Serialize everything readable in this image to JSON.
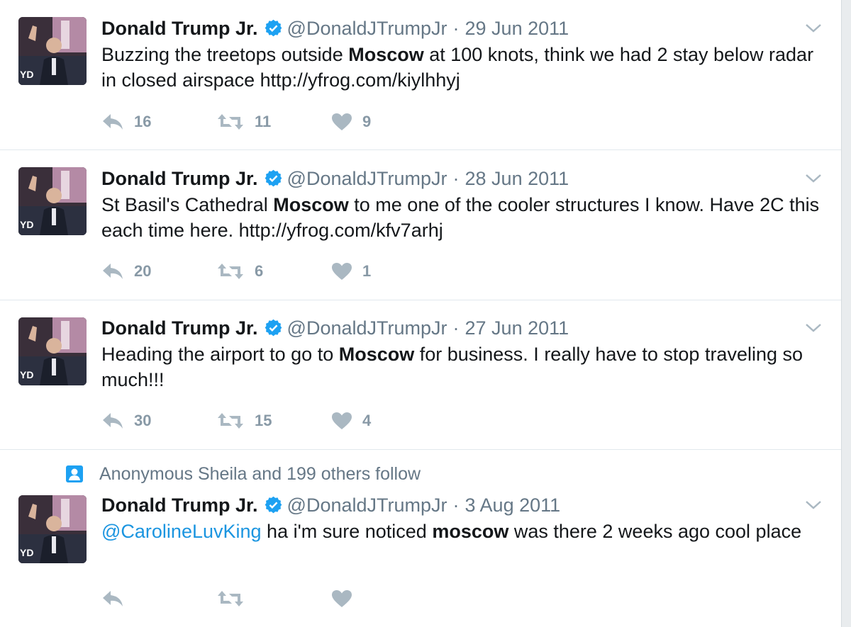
{
  "tweets": [
    {
      "name": "Donald Trump Jr.",
      "handle": "@DonaldJTrumpJr",
      "date": "29 Jun 2011",
      "text_parts": [
        "Buzzing the treetops outside ",
        "Moscow",
        " at 100 knots, think we had 2 stay below radar in closed airspace http://yfrog.com/kiylhhyj"
      ],
      "replies": "16",
      "retweets": "11",
      "likes": "9"
    },
    {
      "name": "Donald Trump Jr.",
      "handle": "@DonaldJTrumpJr",
      "date": "28 Jun 2011",
      "text_parts": [
        "St Basil's Cathedral ",
        "Moscow",
        " to me one of the cooler structures I know. Have 2C this each time here. http://yfrog.com/kfv7arhj"
      ],
      "replies": "20",
      "retweets": "6",
      "likes": "1"
    },
    {
      "name": "Donald Trump Jr.",
      "handle": "@DonaldJTrumpJr",
      "date": "27 Jun 2011",
      "text_parts": [
        "Heading the airport to go to ",
        "Moscow",
        " for business. I really have to stop traveling so much!!!"
      ],
      "replies": "30",
      "retweets": "15",
      "likes": "4"
    },
    {
      "context": "Anonymous Sheila and 199 others follow",
      "name": "Donald Trump Jr.",
      "handle": "@DonaldJTrumpJr",
      "date": "3 Aug 2011",
      "mention": "@CarolineLuvKing",
      "text_parts": [
        " ha i'm sure noticed ",
        "moscow",
        " was there 2 weeks ago cool place"
      ],
      "replies": "",
      "retweets": "",
      "likes": ""
    }
  ],
  "separator": "·",
  "colors": {
    "text": "#14171a",
    "meta": "#657786",
    "action_icon": "#aab8c2",
    "verified": "#1da1f2",
    "mention": "#1b95e0",
    "context_icon": "#1da1f2"
  },
  "icons": [
    "verified-badge-icon",
    "chevron-down-icon",
    "reply-icon",
    "retweet-icon",
    "heart-icon",
    "person-icon"
  ]
}
